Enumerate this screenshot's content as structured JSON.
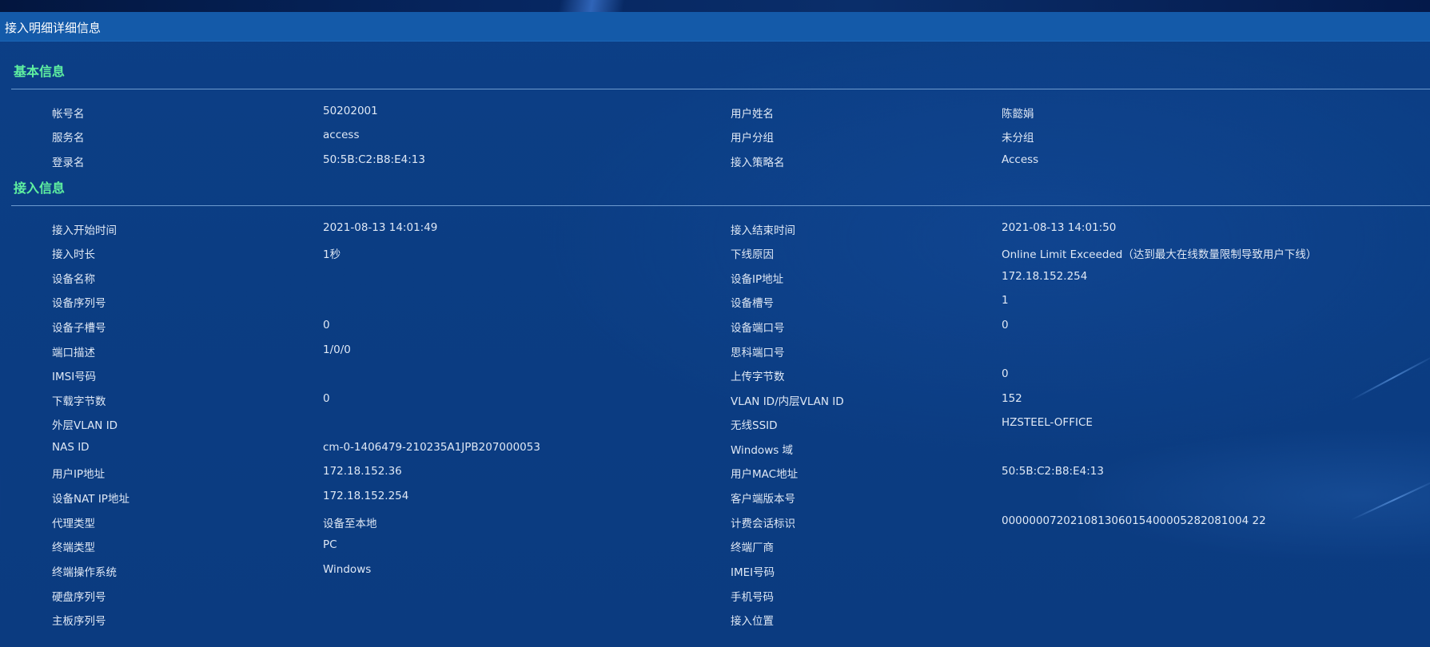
{
  "window_title": "接入明细详细信息",
  "basic_section": {
    "title": "基本信息",
    "rows": [
      {
        "label1": "帐号名",
        "value1": "50202001",
        "label2": "用户姓名",
        "value2": "陈懿娟"
      },
      {
        "label1": "服务名",
        "value1": "access",
        "label2": "用户分组",
        "value2": "未分组"
      },
      {
        "label1": "登录名",
        "value1": "50:5B:C2:B8:E4:13",
        "label2": "接入策略名",
        "value2": "Access"
      }
    ]
  },
  "access_section": {
    "title": "接入信息",
    "rows": [
      {
        "label1": "接入开始时间",
        "value1": "2021-08-13 14:01:49",
        "label2": "接入结束时间",
        "value2": "2021-08-13 14:01:50"
      },
      {
        "label1": "接入时长",
        "value1": "1秒",
        "label2": "下线原因",
        "value2": "Online Limit Exceeded（达到最大在线数量限制导致用户下线）"
      },
      {
        "label1": "设备名称",
        "value1": "",
        "label2": "设备IP地址",
        "value2": "172.18.152.254"
      },
      {
        "label1": "设备序列号",
        "value1": "",
        "label2": "设备槽号",
        "value2": "1"
      },
      {
        "label1": "设备子槽号",
        "value1": "0",
        "label2": "设备端口号",
        "value2": "0"
      },
      {
        "label1": "端口描述",
        "value1": "1/0/0",
        "label2": "思科端口号",
        "value2": ""
      },
      {
        "label1": "IMSI号码",
        "value1": "",
        "label2": "上传字节数",
        "value2": "0"
      },
      {
        "label1": "下载字节数",
        "value1": "0",
        "label2": "VLAN ID/内层VLAN ID",
        "value2": "152"
      },
      {
        "label1": "外层VLAN ID",
        "value1": "",
        "label2": "无线SSID",
        "value2": "HZSTEEL-OFFICE"
      },
      {
        "label1": "NAS ID",
        "value1": "cm-0-1406479-210235A1JPB207000053",
        "label2": "Windows 域",
        "value2": ""
      },
      {
        "label1": "用户IP地址",
        "value1": "172.18.152.36",
        "label2": "用户MAC地址",
        "value2": "50:5B:C2:B8:E4:13"
      },
      {
        "label1": "设备NAT IP地址",
        "value1": "172.18.152.254",
        "label2": "客户端版本号",
        "value2": ""
      },
      {
        "label1": "代理类型",
        "value1": "设备至本地",
        "label2": "计费会话标识",
        "value2": "000000072021081306015400005282081004 22"
      },
      {
        "label1": "终端类型",
        "value1": "PC",
        "label2": "终端厂商",
        "value2": ""
      },
      {
        "label1": "终端操作系统",
        "value1": "Windows",
        "label2": "IMEI号码",
        "value2": ""
      },
      {
        "label1": "硬盘序列号",
        "value1": "",
        "label2": "手机号码",
        "value2": ""
      },
      {
        "label1": "主板序列号",
        "value1": "",
        "label2": "接入位置",
        "value2": ""
      }
    ]
  }
}
